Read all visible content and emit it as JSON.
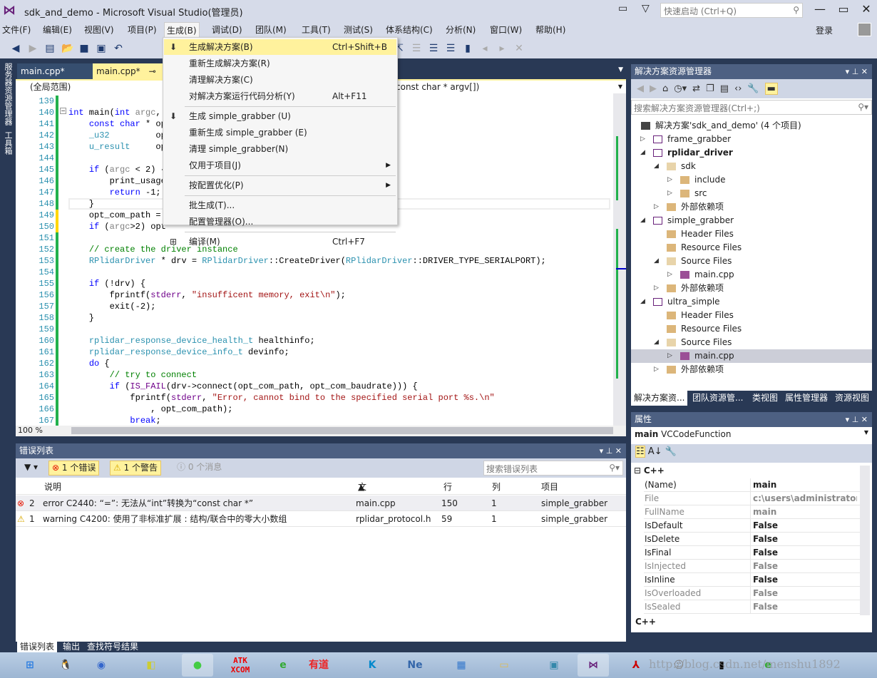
{
  "window": {
    "title": "sdk_and_demo - Microsoft Visual Studio(管理员)",
    "quick_launch_placeholder": "快速启动 (Ctrl+Q)",
    "login": "登录"
  },
  "menubar": [
    "文件(F)",
    "编辑(E)",
    "视图(V)",
    "项目(P)",
    "生成(B)",
    "调试(D)",
    "团队(M)",
    "工具(T)",
    "测试(S)",
    "体系结构(C)",
    "分析(N)",
    "窗口(W)",
    "帮助(H)"
  ],
  "left_sidebar": [
    "服务器资源管理器",
    "工具箱"
  ],
  "editor": {
    "tabs": [
      "main.cpp*",
      "main.cpp*"
    ],
    "scope": "(全局范围)",
    "member": "const char * argv[])",
    "zoom": "100 %",
    "lines": [
      {
        "n": "139",
        "chg": "saved",
        "tok": []
      },
      {
        "n": "140",
        "chg": "saved",
        "tok": [
          [
            "kw",
            "int"
          ],
          [
            "pl",
            " main("
          ],
          [
            "kw",
            "int"
          ],
          [
            "pl",
            " "
          ],
          [
            "pl2",
            "argc"
          ],
          [
            "pl",
            ","
          ]
        ]
      },
      {
        "n": "141",
        "chg": "saved",
        "tok": [
          [
            "pl",
            "    "
          ],
          [
            "kw",
            "const char"
          ],
          [
            "pl",
            " * op"
          ]
        ]
      },
      {
        "n": "142",
        "chg": "saved",
        "tok": [
          [
            "pl",
            "    "
          ],
          [
            "ty",
            "_u32"
          ],
          [
            "pl",
            "         op"
          ]
        ]
      },
      {
        "n": "143",
        "chg": "saved",
        "tok": [
          [
            "pl",
            "    "
          ],
          [
            "ty",
            "u_result"
          ],
          [
            "pl",
            "     op"
          ]
        ]
      },
      {
        "n": "144",
        "chg": "saved",
        "tok": []
      },
      {
        "n": "145",
        "chg": "saved",
        "tok": [
          [
            "pl",
            "    "
          ],
          [
            "kw",
            "if"
          ],
          [
            "pl",
            " ("
          ],
          [
            "pl2",
            "argc"
          ],
          [
            "pl",
            " < 2) {"
          ]
        ]
      },
      {
        "n": "146",
        "chg": "saved",
        "tok": [
          [
            "pl",
            "        print_usage"
          ]
        ]
      },
      {
        "n": "147",
        "chg": "saved",
        "tok": [
          [
            "pl",
            "        "
          ],
          [
            "kw",
            "return"
          ],
          [
            "pl",
            " -1;"
          ]
        ]
      },
      {
        "n": "148",
        "chg": "saved",
        "tok": [
          [
            "pl",
            "    }"
          ]
        ]
      },
      {
        "n": "149",
        "chg": "unsaved",
        "tok": [
          [
            "pl",
            "    opt_com_path = "
          ]
        ]
      },
      {
        "n": "150",
        "chg": "unsaved",
        "tok": [
          [
            "pl",
            "    "
          ],
          [
            "kw",
            "if"
          ],
          [
            "pl",
            " ("
          ],
          [
            "pl2",
            "argc"
          ],
          [
            "pl",
            ">2) opt"
          ]
        ]
      },
      {
        "n": "151",
        "chg": "saved",
        "tok": []
      },
      {
        "n": "152",
        "chg": "saved",
        "tok": [
          [
            "pl",
            "    "
          ],
          [
            "cm",
            "// create the driver instance"
          ]
        ]
      },
      {
        "n": "153",
        "chg": "saved",
        "tok": [
          [
            "pl",
            "    "
          ],
          [
            "ty",
            "RPlidarDriver"
          ],
          [
            "pl",
            " * drv = "
          ],
          [
            "ty",
            "RPlidarDriver"
          ],
          [
            "pl",
            "::CreateDriver("
          ],
          [
            "ty",
            "RPlidarDriver"
          ],
          [
            "pl",
            "::DRIVER_TYPE_SERIALPORT);"
          ]
        ]
      },
      {
        "n": "154",
        "chg": "saved",
        "tok": []
      },
      {
        "n": "155",
        "chg": "saved",
        "tok": [
          [
            "pl",
            "    "
          ],
          [
            "kw",
            "if"
          ],
          [
            "pl",
            " (!drv) {"
          ]
        ]
      },
      {
        "n": "156",
        "chg": "saved",
        "tok": [
          [
            "pl",
            "        fprintf("
          ],
          [
            "mac",
            "stderr"
          ],
          [
            "pl",
            ", "
          ],
          [
            "str",
            "\"insufficent memory, exit\\n\""
          ],
          [
            "pl",
            ");"
          ]
        ]
      },
      {
        "n": "157",
        "chg": "saved",
        "tok": [
          [
            "pl",
            "        exit(-2);"
          ]
        ]
      },
      {
        "n": "158",
        "chg": "saved",
        "tok": [
          [
            "pl",
            "    }"
          ]
        ]
      },
      {
        "n": "159",
        "chg": "saved",
        "tok": []
      },
      {
        "n": "160",
        "chg": "saved",
        "tok": [
          [
            "pl",
            "    "
          ],
          [
            "ty",
            "rplidar_response_device_health_t"
          ],
          [
            "pl",
            " healthinfo;"
          ]
        ]
      },
      {
        "n": "161",
        "chg": "saved",
        "tok": [
          [
            "pl",
            "    "
          ],
          [
            "ty",
            "rplidar_response_device_info_t"
          ],
          [
            "pl",
            " devinfo;"
          ]
        ]
      },
      {
        "n": "162",
        "chg": "saved",
        "tok": [
          [
            "pl",
            "    "
          ],
          [
            "kw",
            "do"
          ],
          [
            "pl",
            " {"
          ]
        ]
      },
      {
        "n": "163",
        "chg": "saved",
        "tok": [
          [
            "pl",
            "        "
          ],
          [
            "cm",
            "// try to connect"
          ]
        ]
      },
      {
        "n": "164",
        "chg": "saved",
        "tok": [
          [
            "pl",
            "        "
          ],
          [
            "kw",
            "if"
          ],
          [
            "pl",
            " ("
          ],
          [
            "mac",
            "IS_FAIL"
          ],
          [
            "pl",
            "(drv->connect(opt_com_path, opt_com_baudrate))) {"
          ]
        ]
      },
      {
        "n": "165",
        "chg": "saved",
        "tok": [
          [
            "pl",
            "            fprintf("
          ],
          [
            "mac",
            "stderr"
          ],
          [
            "pl",
            ", "
          ],
          [
            "str",
            "\"Error, cannot bind to the specified serial port %s.\\n\""
          ]
        ]
      },
      {
        "n": "166",
        "chg": "saved",
        "tok": [
          [
            "pl",
            "                , opt_com_path);"
          ]
        ]
      },
      {
        "n": "167",
        "chg": "saved",
        "tok": [
          [
            "pl",
            "            "
          ],
          [
            "kw",
            "break"
          ],
          [
            "pl",
            ";"
          ]
        ]
      }
    ]
  },
  "build_menu": [
    {
      "label": "生成解决方案(B)",
      "shortcut": "Ctrl+Shift+B",
      "icon": "build-icon",
      "highlighted": true
    },
    {
      "label": "重新生成解决方案(R)"
    },
    {
      "label": "清理解决方案(C)"
    },
    {
      "label": "对解决方案运行代码分析(Y)",
      "shortcut": "Alt+F11"
    },
    {
      "sep": true
    },
    {
      "label": "生成 simple_grabber (U)",
      "icon": "build-icon"
    },
    {
      "label": "重新生成 simple_grabber (E)"
    },
    {
      "label": "清理 simple_grabber(N)"
    },
    {
      "label": "仅用于项目(J)",
      "submenu": true
    },
    {
      "sep": true
    },
    {
      "label": "按配置优化(P)",
      "submenu": true
    },
    {
      "sep": true
    },
    {
      "label": "批生成(T)..."
    },
    {
      "label": "配置管理器(O)..."
    },
    {
      "sep": true
    },
    {
      "label": "编译(M)",
      "shortcut": "Ctrl+F7",
      "icon": "compile-icon"
    }
  ],
  "error_list": {
    "title": "错误列表",
    "errors": "1 个错误",
    "warnings": "1 个警告",
    "messages": "0 个消息",
    "search_placeholder": "搜索错误列表",
    "columns": [
      "说明",
      "文件",
      "行",
      "列",
      "项目"
    ],
    "rows": [
      {
        "type": "error",
        "num": "2",
        "desc": "error C2440: “=”: 无法从“int”转换为“const char *”",
        "file": "main.cpp",
        "line": "150",
        "col": "1",
        "project": "simple_grabber"
      },
      {
        "type": "warning",
        "num": "1",
        "desc": "warning C4200: 使用了非标准扩展 : 结构/联合中的零大小数组",
        "file": "rplidar_protocol.h",
        "line": "59",
        "col": "1",
        "project": "simple_grabber"
      }
    ],
    "bottom_tabs": [
      "错误列表",
      "输出",
      "查找符号结果"
    ]
  },
  "solution_explorer": {
    "title": "解决方案资源管理器",
    "search_placeholder": "搜索解决方案资源管理器(Ctrl+;)",
    "tree": [
      {
        "label": "解决方案'sdk_and_demo' (4 个项目)",
        "level": 0,
        "icon": "solution",
        "exp": ""
      },
      {
        "label": "frame_grabber",
        "level": 0,
        "icon": "project",
        "exp": "collapsed"
      },
      {
        "label": "rplidar_driver",
        "level": 0,
        "icon": "project",
        "exp": "expanded",
        "bold": true
      },
      {
        "label": "sdk",
        "level": 1,
        "icon": "filter-open",
        "exp": "expanded"
      },
      {
        "label": "include",
        "level": 2,
        "icon": "filter",
        "exp": "collapsed"
      },
      {
        "label": "src",
        "level": 2,
        "icon": "filter",
        "exp": "collapsed"
      },
      {
        "label": "外部依赖项",
        "level": 1,
        "icon": "deps",
        "exp": "collapsed"
      },
      {
        "label": "simple_grabber",
        "level": 0,
        "icon": "project",
        "exp": "expanded"
      },
      {
        "label": "Header Files",
        "level": 1,
        "icon": "filter",
        "exp": ""
      },
      {
        "label": "Resource Files",
        "level": 1,
        "icon": "filter",
        "exp": ""
      },
      {
        "label": "Source Files",
        "level": 1,
        "icon": "filter-open",
        "exp": "expanded"
      },
      {
        "label": "main.cpp",
        "level": 2,
        "icon": "cpp",
        "exp": "collapsed"
      },
      {
        "label": "外部依赖项",
        "level": 1,
        "icon": "deps",
        "exp": "collapsed"
      },
      {
        "label": "ultra_simple",
        "level": 0,
        "icon": "project",
        "exp": "expanded"
      },
      {
        "label": "Header Files",
        "level": 1,
        "icon": "filter",
        "exp": ""
      },
      {
        "label": "Resource Files",
        "level": 1,
        "icon": "filter",
        "exp": ""
      },
      {
        "label": "Source Files",
        "level": 1,
        "icon": "filter-open",
        "exp": "expanded"
      },
      {
        "label": "main.cpp",
        "level": 2,
        "icon": "cpp",
        "exp": "collapsed",
        "selected": true
      },
      {
        "label": "外部依赖项",
        "level": 1,
        "icon": "deps",
        "exp": "collapsed"
      }
    ],
    "tabs": [
      "解决方案资...",
      "团队资源管...",
      "类视图",
      "属性管理器",
      "资源视图"
    ]
  },
  "properties": {
    "title": "属性",
    "object_name": "main",
    "object_type": "VCCodeFunction",
    "category": "C++",
    "rows": [
      {
        "k": "(Name)",
        "v": "main",
        "ro": false
      },
      {
        "k": "File",
        "v": "c:\\users\\administrator\\de",
        "ro": true
      },
      {
        "k": "FullName",
        "v": "main",
        "ro": true
      },
      {
        "k": "IsDefault",
        "v": "False",
        "ro": false
      },
      {
        "k": "IsDelete",
        "v": "False",
        "ro": false
      },
      {
        "k": "IsFinal",
        "v": "False",
        "ro": false
      },
      {
        "k": "IsInjected",
        "v": "False",
        "ro": true
      },
      {
        "k": "IsInline",
        "v": "False",
        "ro": false
      },
      {
        "k": "IsOverloaded",
        "v": "False",
        "ro": true
      },
      {
        "k": "IsSealed",
        "v": "False",
        "ro": true
      }
    ],
    "description": "C++"
  },
  "taskbar": {
    "apps": [
      "start",
      "qq",
      "school",
      "sticky-notes",
      "wechat",
      "ATK XCOM",
      "ie-green",
      "有道",
      "K",
      "Ne",
      "control-panel",
      "explorer",
      "photo-viewer",
      "visual-studio",
      "pdf",
      "ghost",
      "cmd",
      "ie-green-2"
    ],
    "watermark": "http://blog.csdn.net/menshu1892"
  },
  "colors": {
    "accent_yellow": "#fff29d",
    "chrome": "#d6dbe9",
    "dark": "#293955",
    "panel_title": "#4d6082",
    "vs_purple": "#68217a"
  }
}
